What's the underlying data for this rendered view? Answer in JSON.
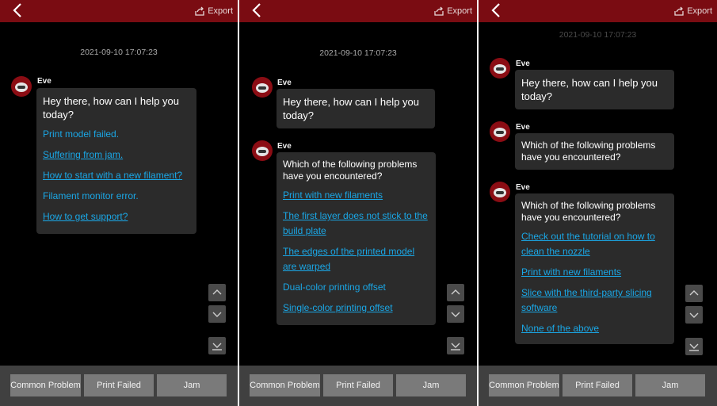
{
  "header": {
    "export_label": "Export"
  },
  "timestamp": "2021-09-10 17:07:23",
  "sender": "Eve",
  "greeting": "Hey there, how can I help you today?",
  "screen1_options": [
    "Print model failed.",
    "Suffering from jam.",
    "How to start with a new filament?",
    "Filament monitor error.",
    "How to get support?"
  ],
  "question": "Which of the following problems have you encountered?",
  "screen2_options": [
    "Print with new filaments",
    "The first layer does not stick to the build plate",
    "The edges of the printed model are warped",
    "Dual-color printing offset",
    "Single-color printing offset"
  ],
  "screen3_options": [
    "Check out the tutorial on how to clean the nozzle",
    "Print with new filaments",
    "Slice with the third-party slicing software",
    "None of the above"
  ],
  "quick_buttons": [
    "Common Problem",
    "Print Failed",
    "Jam"
  ],
  "icons": {
    "back": "chevron-left-icon",
    "export": "share-export-icon",
    "avatar": "robot-eve-icon",
    "scroll_up": "chevron-up-icon",
    "scroll_down": "chevron-down-icon",
    "scroll_bottom": "scroll-to-bottom-icon"
  },
  "colors": {
    "topbar": "#7a0c12",
    "background": "#000000",
    "bubble": "#2b2b2b",
    "link": "#1aa7e6",
    "bottombar": "#404040",
    "button": "#7a7a7a"
  }
}
